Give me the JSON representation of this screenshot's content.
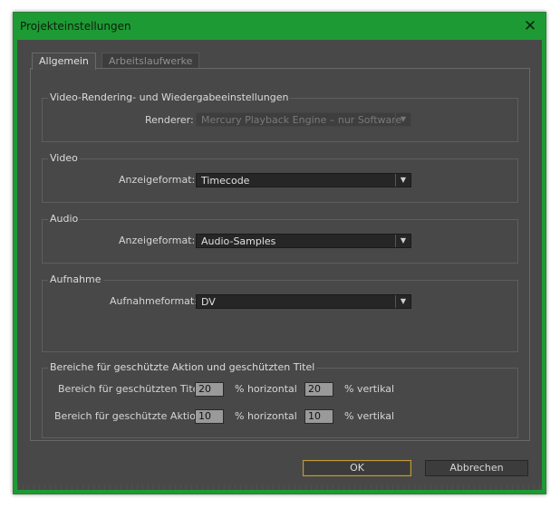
{
  "window": {
    "title": "Projekteinstellungen",
    "close_glyph": "✕"
  },
  "tabs": [
    {
      "label": "Allgemein",
      "active": true
    },
    {
      "label": "Arbeitslaufwerke",
      "active": false
    }
  ],
  "video_rendering": {
    "legend": "Video-Rendering- und Wiedergabeeinstellungen",
    "renderer_label": "Renderer:",
    "renderer_value": "Mercury Playback Engine – nur Software",
    "renderer_enabled": false
  },
  "video": {
    "legend": "Video",
    "format_label": "Anzeigeformat:",
    "format_value": "Timecode"
  },
  "audio": {
    "legend": "Audio",
    "format_label": "Anzeigeformat:",
    "format_value": "Audio-Samples"
  },
  "capture": {
    "legend": "Aufnahme",
    "format_label": "Aufnahmeformat:",
    "format_value": "DV"
  },
  "safe_margins": {
    "legend": "Bereiche für geschützte Aktion und geschützten Titel",
    "title_safe_label": "Bereich für geschützten Titel",
    "title_safe_horizontal": "20",
    "title_safe_vertical": "20",
    "action_safe_label": "Bereich für geschützte Aktion",
    "action_safe_horizontal": "10",
    "action_safe_vertical": "10",
    "horizontal_unit": "% horizontal",
    "vertical_unit": "% vertikal"
  },
  "buttons": {
    "ok": "OK",
    "cancel": "Abbrechen"
  },
  "colors": {
    "titlebar": "#1e9a34",
    "dialog_bg": "#484848",
    "default_button_border": "#c29a3a"
  },
  "dropdown_arrow_glyph": "▼"
}
